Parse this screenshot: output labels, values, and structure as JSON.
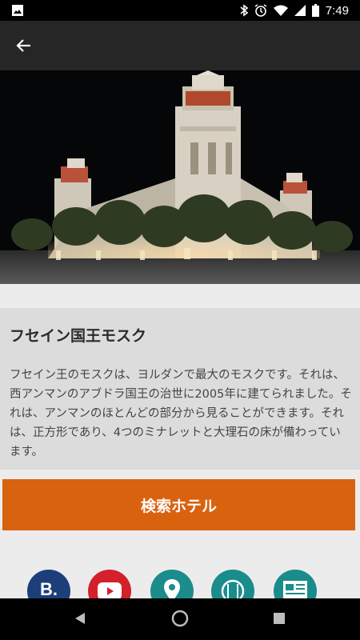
{
  "status_bar": {
    "time": "7:49",
    "icons": [
      "image-icon",
      "bluetooth-icon",
      "alarm-icon",
      "wifi-icon",
      "signal-icon",
      "battery-icon"
    ]
  },
  "app_bar": {
    "back_icon": "arrow-left-icon"
  },
  "hero": {
    "subject": "mosque at night photo"
  },
  "place": {
    "title": "フセイン国王モスク",
    "description": "フセイン王のモスクは、ヨルダンで最大のモスクです。それは、西アンマンのアブドラ国王の治世に2005年に建てられました。それは、アンマンのほとんどの部分から見ることができます。それは、正方形であり、4つのミナレットと大理石の床が備わっています。"
  },
  "search_button": {
    "label": "検索ホテル",
    "color": "#d9620f"
  },
  "action_icons": [
    {
      "name": "booking-icon",
      "color": "#1c3f7a"
    },
    {
      "name": "youtube-icon",
      "color": "#d4202a"
    },
    {
      "name": "map-pin-icon",
      "color": "#1a8c8c"
    },
    {
      "name": "restaurant-icon",
      "color": "#1a8c8c"
    },
    {
      "name": "news-icon",
      "color": "#1a8c8c"
    }
  ],
  "nav_bar": {
    "icons": [
      "back-triangle-icon",
      "home-circle-icon",
      "recents-square-icon"
    ]
  }
}
